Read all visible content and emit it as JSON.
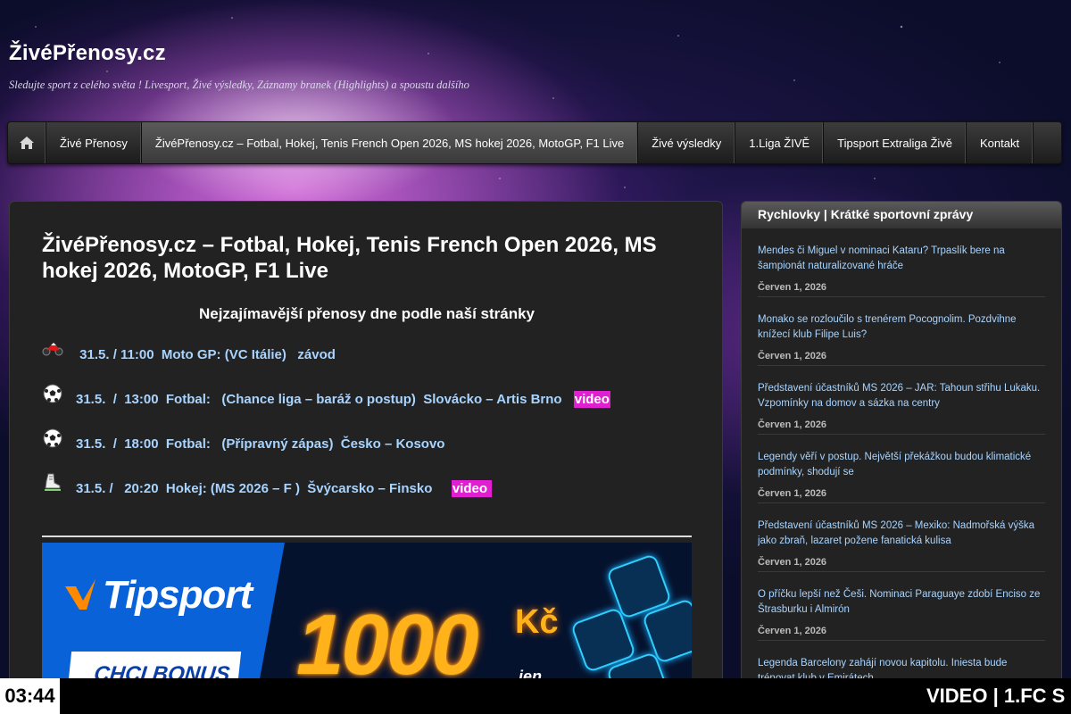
{
  "site": {
    "title": "ŽivéPřenosy.cz",
    "tagline": "Sledujte sport z celého světa ! Livesport, Živé výsledky, Záznamy branek (Highlights) a spoustu dalšího"
  },
  "nav": {
    "home_icon": "home-icon",
    "items": [
      "Živé Přenosy",
      "ŽivéPřenosy.cz – Fotbal, Hokej, Tenis French Open 2026, MS hokej 2026, MotoGP, F1 Live",
      "Živé výsledky",
      "1.Liga ŽIVĚ",
      "Tipsport Extraliga Živě",
      "Kontakt"
    ],
    "active_index": 1
  },
  "main": {
    "title": "ŽivéPřenosy.cz – Fotbal, Hokej, Tenis French Open 2026, MS hokej 2026, MotoGP, F1 Live",
    "subtitle": "Nejzajímavější přenosy dne podle naší stránky",
    "events": [
      {
        "icon": "motorbike-icon",
        "text": " 31.5. / 11:00  Moto GP: (VC Itálie)   závod",
        "video": ""
      },
      {
        "icon": "soccer-ball-icon",
        "text": "31.5.  /  13:00  Fotbal:   (Chance liga – baráž o postup)  Slovácko – Artis Brno ",
        "video": "video"
      },
      {
        "icon": "soccer-ball-icon",
        "text": "31.5.  /  18:00  Fotbal:   (Přípravný zápas)  Česko – Kosovo",
        "video": ""
      },
      {
        "icon": "hockey-skate-icon",
        "text": "31.5. /   20:20  Hokej: (MS 2026 – F )  Švýcarsko – Finsko   ",
        "video": "video "
      }
    ],
    "banner": {
      "brand": "Tipsport",
      "cta": "CHCI BONUS",
      "amount": "1000",
      "currency": "Kč",
      "note": "jen"
    }
  },
  "sidebar": {
    "heading": "Rychlovky | Krátké sportovní zprávy",
    "news": [
      {
        "title": "Mendes či Miguel v nominaci Kataru? Trpaslík bere na šampionát naturalizované hráče",
        "date": "Červen 1, 2026"
      },
      {
        "title": "Monako se rozloučilo s trenérem Pocognolim. Pozdvihne knížecí klub Filipe Luis?",
        "date": "Červen 1, 2026"
      },
      {
        "title": "Představení účastníků MS 2026 – JAR: Tahoun střihu Lukaku. Vzpomínky na domov a sázka na centry",
        "date": "Červen 1, 2026"
      },
      {
        "title": "Legendy věří v postup. Největší překážkou budou klimatické podmínky, shodují se",
        "date": "Červen 1, 2026"
      },
      {
        "title": "Představení účastníků MS 2026 – Mexiko: Nadmořská výška jako zbraň, lazaret požene fanatická kulisa",
        "date": "Červen 1, 2026"
      },
      {
        "title": "O příčku lepší než Češi. Nominaci Paraguaye zdobí Enciso ze Štrasburku i Almirón",
        "date": "Červen 1, 2026"
      },
      {
        "title": "Legenda Barcelony zahájí novou kapitolu. Iniesta bude trénovat klub v Emirátech",
        "date": ""
      }
    ]
  },
  "ticker": {
    "clock": "03:44",
    "text": "VIDEO | 1.FC S"
  },
  "colors": {
    "link": "#a8d4ff",
    "video_badge": "#e020d0",
    "panel": "#222222"
  }
}
